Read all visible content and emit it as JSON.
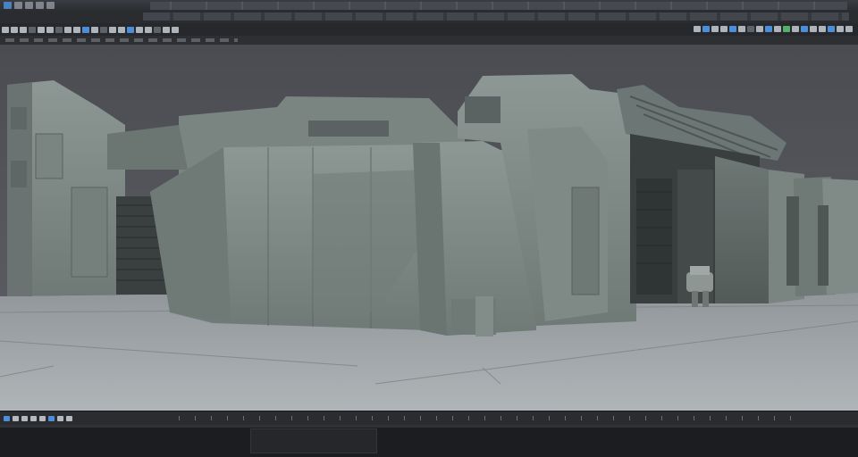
{
  "window": {
    "menu_icons": [
      "app-icon",
      "file-icon",
      "edit-icon",
      "view-icon",
      "window-icon"
    ],
    "accent": "#4c8fd8"
  },
  "toolbar": {
    "left_tools": [
      "select-tool",
      "move-tool",
      "rotate-tool",
      "scale-tool",
      "snap-tool",
      "grid-tool",
      "layer-tool",
      "camera-tool",
      "light-tool",
      "mesh-tool",
      "render-tool",
      "settings-tool"
    ],
    "right_tools": [
      "view-persp-tool",
      "view-top-tool",
      "view-front-tool",
      "shading-tool",
      "wireframe-tool",
      "material-tool",
      "texture-tool",
      "lighting-tool",
      "shadow-tool",
      "isolate-tool",
      "frame-tool",
      "hud-tool"
    ]
  },
  "viewport": {
    "scene": "sci-fi-hangar-bunker",
    "background": "#505257",
    "floor_color": "#a6abae",
    "structure_color": "#7d8784"
  },
  "timeline": {
    "icons": [
      "play-icon",
      "stop-icon",
      "key-icon",
      "rewind-icon",
      "forward-icon",
      "loop-icon"
    ]
  }
}
